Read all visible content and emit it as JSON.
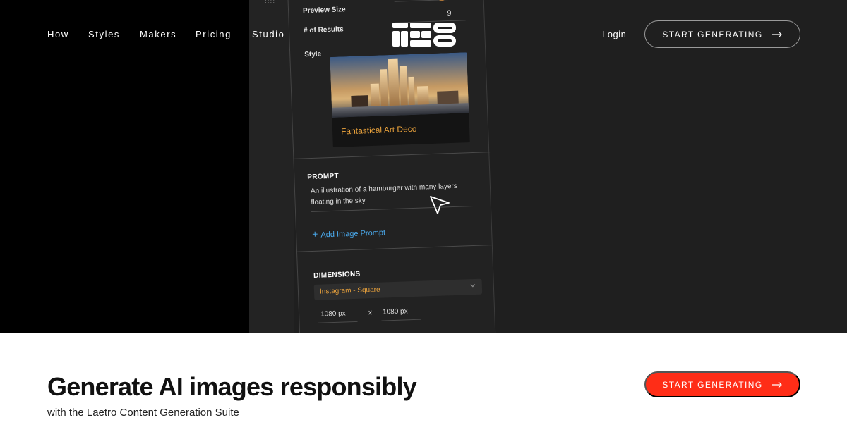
{
  "nav": {
    "links": [
      "How",
      "Styles",
      "Makers",
      "Pricing",
      "Studio"
    ],
    "login": "Login",
    "cta": "START GENERATING"
  },
  "app_preview": {
    "rail_mark": "!!!!",
    "preview_size_label": "Preview Size",
    "results_label": "# of Results",
    "results_value": "9",
    "style_label": "Style",
    "style_name": "Fantastical Art Deco",
    "prompt_title": "PROMPT",
    "prompt_text": "An illustration of a hamburger with many layers floating in the sky.",
    "add_image_prompt": "Add Image Prompt",
    "dimensions_title": "DIMENSIONS",
    "dimension_preset": "Instagram - Square",
    "width": "1080 px",
    "times": "x",
    "height": "1080 px"
  },
  "hero_bottom": {
    "headline": "Generate AI images responsibly",
    "subline": "with the Laetro Content Generation Suite",
    "cta": "START GENERATING"
  },
  "colors": {
    "accent_red": "#ff2d17",
    "accent_orange": "#e8a13c",
    "link_blue": "#4aa8ea",
    "hero_bg": "#1f1f1f"
  }
}
